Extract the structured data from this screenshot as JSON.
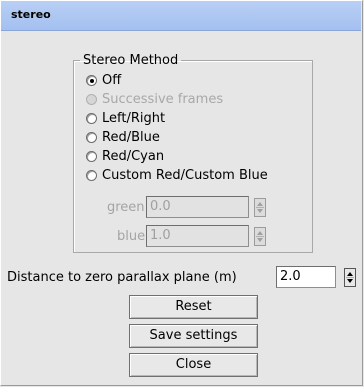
{
  "window": {
    "title": "stereo"
  },
  "stereo_method": {
    "legend": "Stereo Method",
    "options": [
      {
        "label": "Off",
        "checked": true,
        "enabled": true
      },
      {
        "label": "Successive frames",
        "checked": false,
        "enabled": false
      },
      {
        "label": "Left/Right",
        "checked": false,
        "enabled": true
      },
      {
        "label": "Red/Blue",
        "checked": false,
        "enabled": true
      },
      {
        "label": "Red/Cyan",
        "checked": false,
        "enabled": true
      },
      {
        "label": "Custom Red/Custom Blue",
        "checked": false,
        "enabled": true
      }
    ],
    "green": {
      "label": "green",
      "value": "0.0"
    },
    "blue": {
      "label": "blue",
      "value": "1.0"
    }
  },
  "distance": {
    "label": "Distance to zero parallax plane (m)",
    "value": "2.0"
  },
  "buttons": {
    "reset": "Reset",
    "save": "Save settings",
    "close": "Close"
  },
  "icons": {
    "spinner": "spinner-arrows-icon",
    "radio": "radio-button-icon"
  }
}
